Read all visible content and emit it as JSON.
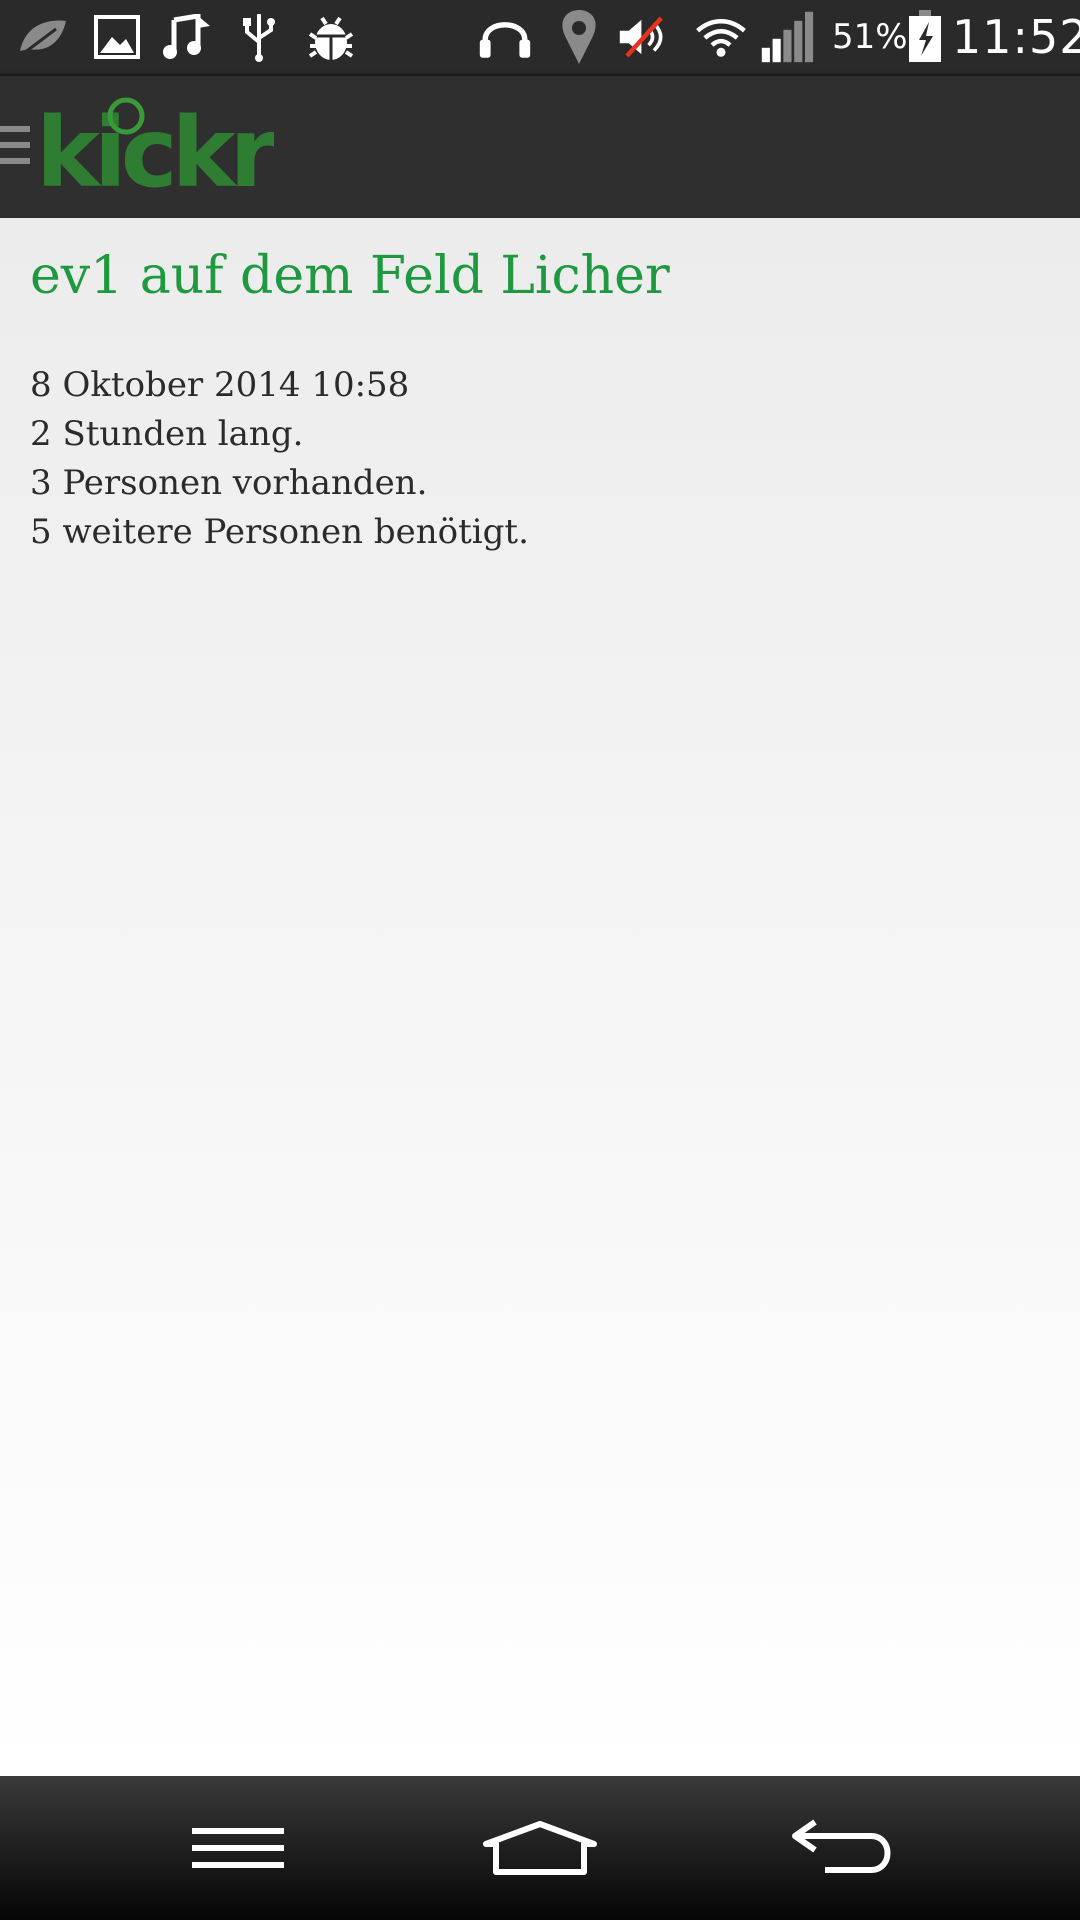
{
  "status_bar": {
    "left_icons": [
      "leaf-icon",
      "gallery-icon",
      "music-icon",
      "usb-icon",
      "android-debug-icon"
    ],
    "right_icons": [
      "headphones-icon",
      "location-icon",
      "volume-muted-icon",
      "wifi-icon",
      "signal-icon"
    ],
    "battery_percent": "51%",
    "clock": "11:52"
  },
  "app_bar": {
    "logo_text": "kickr",
    "menu_icon": "drawer-icon"
  },
  "event": {
    "title": "ev1 auf dem Feld Licher",
    "date": "8 Oktober 2014 10:58",
    "duration": "2 Stunden lang.",
    "present": "3 Personen vorhanden.",
    "needed": "5 weitere Personen benötigt."
  },
  "nav_bar": {
    "buttons": [
      "menu-icon",
      "home-icon",
      "back-icon"
    ]
  },
  "colors": {
    "accent_green": "#1f9940",
    "text_dark": "#2b2b2b",
    "bar_dark": "#2f2f2f"
  }
}
